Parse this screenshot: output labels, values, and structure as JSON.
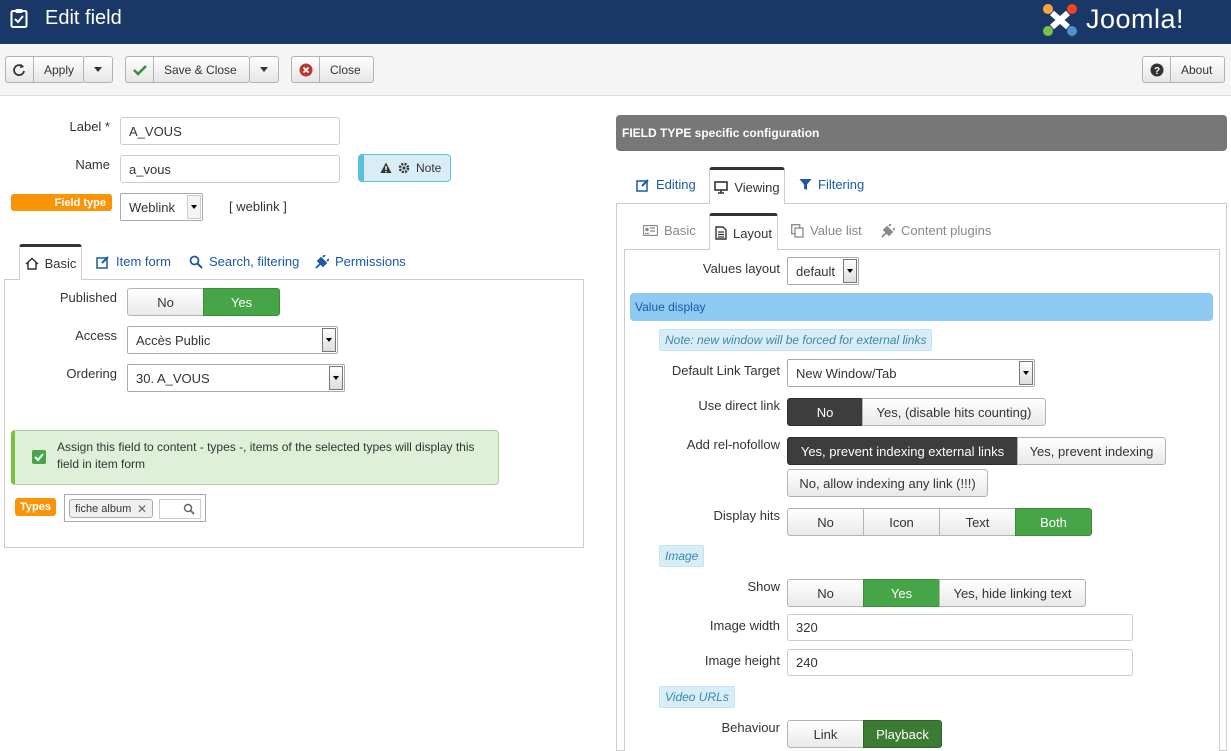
{
  "header": {
    "title": "Edit field",
    "brand": "Joomla!"
  },
  "toolbar": {
    "apply": "Apply",
    "save_close": "Save & Close",
    "close": "Close",
    "about": "About"
  },
  "left": {
    "label_label": "Label *",
    "label_value": "A_VOUS",
    "name_label": "Name",
    "name_value": "a_vous",
    "note_label": "Note",
    "field_type_label": "Field type",
    "field_type_value": "Weblink",
    "field_type_code": "[ weblink ]",
    "tabs": [
      "Basic",
      "Item form",
      "Search, filtering",
      "Permissions"
    ],
    "published_label": "Published",
    "published_options": [
      "No",
      "Yes"
    ],
    "access_label": "Access",
    "access_value": "Accès Public",
    "ordering_label": "Ordering",
    "ordering_value": "30. A_VOUS",
    "assign_text": "Assign this field to content - types -, items of the selected types will display this field in item form",
    "types_label": "Types",
    "types_tag": "fiche album"
  },
  "right": {
    "header": "FIELD TYPE specific configuration",
    "tabs": [
      "Editing",
      "Viewing",
      "Filtering"
    ],
    "subtabs": [
      "Basic",
      "Layout",
      "Value list",
      "Content plugins"
    ],
    "values_layout_label": "Values layout",
    "values_layout_value": "default",
    "value_display": "Value display",
    "note_external": "Note: new window will be forced for external links",
    "link_target_label": "Default Link Target",
    "link_target_value": "New Window/Tab",
    "direct_link_label": "Use direct link",
    "direct_link_options": [
      "No",
      "Yes, (disable hits counting)"
    ],
    "relnofollow_label": "Add rel-nofollow",
    "relnofollow_options": [
      "Yes, prevent indexing external links",
      "Yes, prevent indexing",
      "No, allow indexing any link (!!!)"
    ],
    "hits_label": "Display hits",
    "hits_options": [
      "No",
      "Icon",
      "Text",
      "Both"
    ],
    "image_section": "Image",
    "show_label": "Show",
    "show_options": [
      "No",
      "Yes",
      "Yes, hide linking text"
    ],
    "image_width_label": "Image width",
    "image_width_value": "320",
    "image_height_label": "Image height",
    "image_height_value": "240",
    "video_section": "Video URLs",
    "behaviour_label": "Behaviour",
    "behaviour_options": [
      "Link",
      "Playback"
    ]
  }
}
